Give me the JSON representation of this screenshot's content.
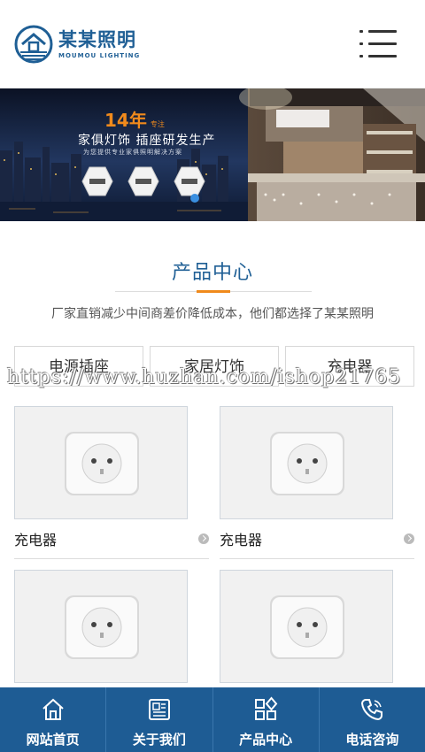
{
  "header": {
    "logo_cn": "某某照明",
    "logo_en": "MOUMOU LIGHTING"
  },
  "banner": {
    "headline": "14年",
    "headline_tag": "专注",
    "subtitle": "家俱灯饰  插座研发生产",
    "note": "为您提供专业家俱照明解决方案"
  },
  "section": {
    "title": "产品中心",
    "description": "厂家直销减少中间商差价降低成本，他们都选择了某某照明"
  },
  "categories": [
    "电源插座",
    "家居灯饰",
    "充电器"
  ],
  "watermark": "https://www.huzhan.com/ishop21765",
  "products": [
    {
      "name": "充电器"
    },
    {
      "name": "充电器"
    },
    {
      "name": "",
      "partial": true
    },
    {
      "name": "",
      "partial": true
    }
  ],
  "footer_nav": [
    {
      "label": "网站首页",
      "icon": "home-icon"
    },
    {
      "label": "关于我们",
      "icon": "newspaper-icon"
    },
    {
      "label": "产品中心",
      "icon": "grid-icon"
    },
    {
      "label": "电话咨询",
      "icon": "phone-icon"
    }
  ],
  "colors": {
    "brand_blue": "#1f5f95",
    "accent_orange": "#f08a1c",
    "footer_bg": "#1e5c94"
  }
}
